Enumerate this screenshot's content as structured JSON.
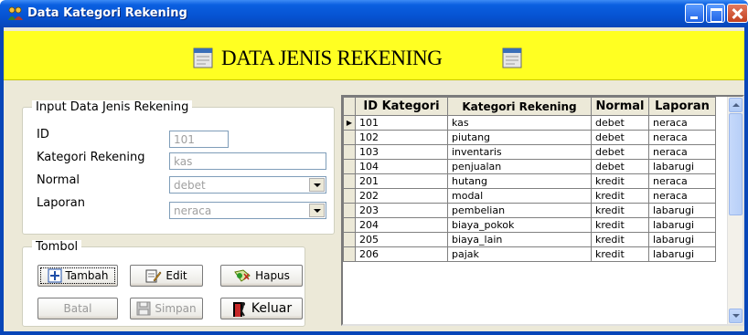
{
  "window": {
    "title": "Data Kategori Rekening"
  },
  "banner": {
    "title": "DATA JENIS REKENING"
  },
  "input_group": {
    "legend": "Input Data Jenis Rekening",
    "fields": [
      {
        "label": "ID",
        "value": "101"
      },
      {
        "label": "Kategori Rekening",
        "value": "kas"
      },
      {
        "label": "Normal",
        "value": "debet"
      },
      {
        "label": "Laporan",
        "value": "neraca"
      }
    ]
  },
  "tombol_group": {
    "legend": "Tombol",
    "buttons": {
      "tambah": "Tambah",
      "edit": "Edit",
      "hapus": "Hapus",
      "batal": "Batal",
      "simpan": "Simpan",
      "keluar": "Keluar"
    }
  },
  "grid": {
    "columns": [
      "ID Kategori",
      "Kategori Rekening",
      "Normal",
      "Laporan"
    ],
    "rows": [
      [
        "101",
        "kas",
        "debet",
        "neraca"
      ],
      [
        "102",
        "piutang",
        "debet",
        "neraca"
      ],
      [
        "103",
        "inventaris",
        "debet",
        "neraca"
      ],
      [
        "104",
        "penjualan",
        "debet",
        "labarugi"
      ],
      [
        "201",
        "hutang",
        "kredit",
        "neraca"
      ],
      [
        "202",
        "modal",
        "kredit",
        "neraca"
      ],
      [
        "203",
        "pembelian",
        "kredit",
        "labarugi"
      ],
      [
        "204",
        "biaya_pokok",
        "kredit",
        "labarugi"
      ],
      [
        "205",
        "biaya_lain",
        "kredit",
        "labarugi"
      ],
      [
        "206",
        "pajak",
        "kredit",
        "labarugi"
      ]
    ]
  },
  "icons": {
    "app": "people-icon",
    "banner": "notepad-icon",
    "tambah": "plus-icon",
    "edit": "edit-icon",
    "hapus": "delete-icon",
    "simpan": "floppy-icon",
    "keluar": "exit-icon"
  }
}
